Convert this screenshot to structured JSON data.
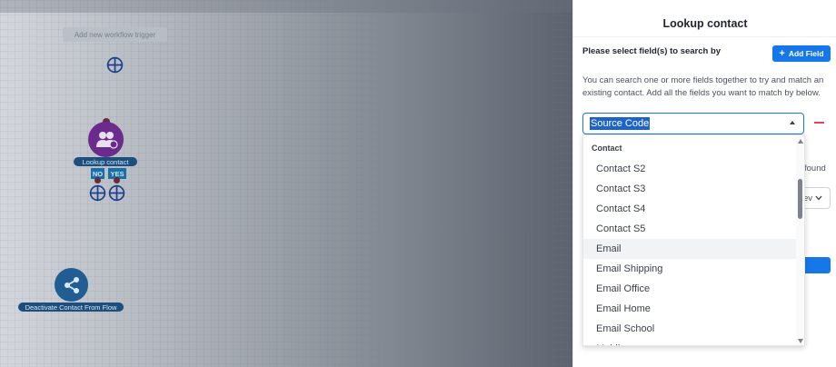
{
  "canvas": {
    "trigger_button": "Add new workflow trigger",
    "nodes": {
      "lookup_label": "Lookup contact",
      "no_tag": "NO",
      "yes_tag": "YES",
      "deactivate_label": "Deactivate Contact From Flow"
    }
  },
  "panel": {
    "title": "Lookup contact",
    "select_label": "Please select field(s) to search by",
    "add_field_button": "Add Field",
    "help_text": "You can search one or more fields together to try and match an existing contact. Add all the fields you want to match by below.",
    "selected_field": "Source Code",
    "behind_text": "found",
    "behind_select_fragment": "ev"
  },
  "dropdown": {
    "group_label": "Contact",
    "items": [
      "Contact S2",
      "Contact S3",
      "Contact S4",
      "Contact S5",
      "Email",
      "Email Shipping",
      "Email Office",
      "Email Home",
      "Email School",
      "Mobile"
    ],
    "hovered_item": "Email"
  },
  "colors": {
    "accent": "#1677e8",
    "lookup_node": "#6a2b8c",
    "deactivate_node": "#1f5d92",
    "remove": "#e0455a"
  }
}
